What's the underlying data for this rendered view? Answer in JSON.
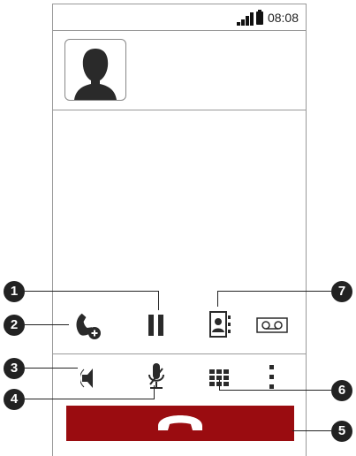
{
  "statusbar": {
    "time": "08:08"
  },
  "callouts": [
    "1",
    "2",
    "3",
    "4",
    "5",
    "6",
    "7"
  ],
  "colors": {
    "end_call": "#9a0c10",
    "icon_dark": "#2a2a2a"
  }
}
